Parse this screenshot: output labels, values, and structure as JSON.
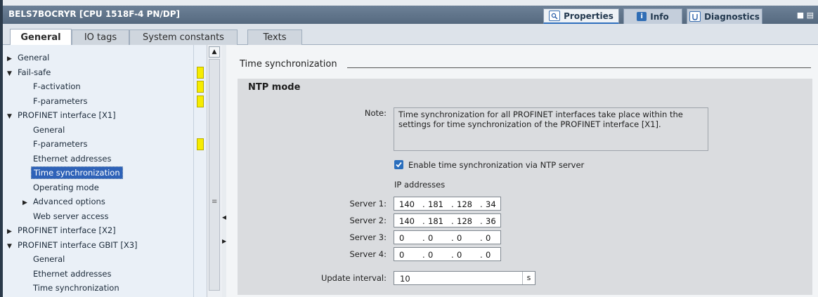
{
  "titlebar": {
    "title": "BELS7BOCRYR [CPU 1518F-4 PN/DP]",
    "tabs": [
      {
        "label": "Properties",
        "icon": "properties-icon",
        "active": true
      },
      {
        "label": "Info",
        "icon": "info-icon",
        "active": false
      },
      {
        "label": "Diagnostics",
        "icon": "diagnostics-icon",
        "active": false
      }
    ],
    "window_controls": "■ ▤"
  },
  "inspector_tabs": [
    {
      "label": "General",
      "active": true
    },
    {
      "label": "IO tags",
      "active": false
    },
    {
      "label": "System constants",
      "active": false
    },
    {
      "label": "Texts",
      "active": false
    }
  ],
  "nav": {
    "items": [
      {
        "label": "General",
        "level": 0,
        "expander": "▶",
        "marker": false,
        "selected": false
      },
      {
        "label": "Fail-safe",
        "level": 0,
        "expander": "▼",
        "marker": true,
        "selected": false
      },
      {
        "label": "F-activation",
        "level": 1,
        "expander": "",
        "marker": true,
        "selected": false
      },
      {
        "label": "F-parameters",
        "level": 1,
        "expander": "",
        "marker": true,
        "selected": false
      },
      {
        "label": "PROFINET interface [X1]",
        "level": 0,
        "expander": "▼",
        "marker": false,
        "selected": false
      },
      {
        "label": "General",
        "level": 1,
        "expander": "",
        "marker": false,
        "selected": false
      },
      {
        "label": "F-parameters",
        "level": 1,
        "expander": "",
        "marker": true,
        "selected": false
      },
      {
        "label": "Ethernet addresses",
        "level": 1,
        "expander": "",
        "marker": false,
        "selected": false
      },
      {
        "label": "Time synchronization",
        "level": 1,
        "expander": "",
        "marker": false,
        "selected": true
      },
      {
        "label": "Operating mode",
        "level": 1,
        "expander": "",
        "marker": false,
        "selected": false
      },
      {
        "label": "Advanced options",
        "level": 1,
        "expander": "▶",
        "marker": false,
        "selected": false
      },
      {
        "label": "Web server access",
        "level": 1,
        "expander": "",
        "marker": false,
        "selected": false
      },
      {
        "label": "PROFINET interface [X2]",
        "level": 0,
        "expander": "▶",
        "marker": false,
        "selected": false
      },
      {
        "label": "PROFINET interface GBIT [X3]",
        "level": 0,
        "expander": "▼",
        "marker": false,
        "selected": false
      },
      {
        "label": "General",
        "level": 1,
        "expander": "",
        "marker": false,
        "selected": false
      },
      {
        "label": "Ethernet addresses",
        "level": 1,
        "expander": "",
        "marker": false,
        "selected": false
      },
      {
        "label": "Time synchronization",
        "level": 1,
        "expander": "",
        "marker": false,
        "selected": false
      }
    ],
    "scroll_up": "▲",
    "scroll_grip": "≡",
    "splitter_arrows": [
      "◀",
      "▶"
    ]
  },
  "main": {
    "section_title": "Time synchronization",
    "group_title": "NTP mode",
    "note_label": "Note:",
    "note_text": "Time synchronization for all PROFINET interfaces take place within the settings for time synchronization of the PROFINET interface [X1].",
    "ntp_checkbox": {
      "label": "Enable time synchronization via NTP server",
      "checked": true
    },
    "ip_header": "IP addresses",
    "servers": [
      {
        "label": "Server 1:",
        "octets": [
          "140",
          "181",
          "128",
          "34"
        ]
      },
      {
        "label": "Server 2:",
        "octets": [
          "140",
          "181",
          "128",
          "36"
        ]
      },
      {
        "label": "Server 3:",
        "octets": [
          "0",
          "0",
          "0",
          "0"
        ]
      },
      {
        "label": "Server 4:",
        "octets": [
          "0",
          "0",
          "0",
          "0"
        ]
      }
    ],
    "ip_separator": ".",
    "update_interval": {
      "label": "Update interval:",
      "value": "10",
      "unit": "s"
    }
  },
  "colors": {
    "selection": "#2e62b8",
    "marker": "#f6ec00",
    "checkbox": "#2a6ebd"
  }
}
